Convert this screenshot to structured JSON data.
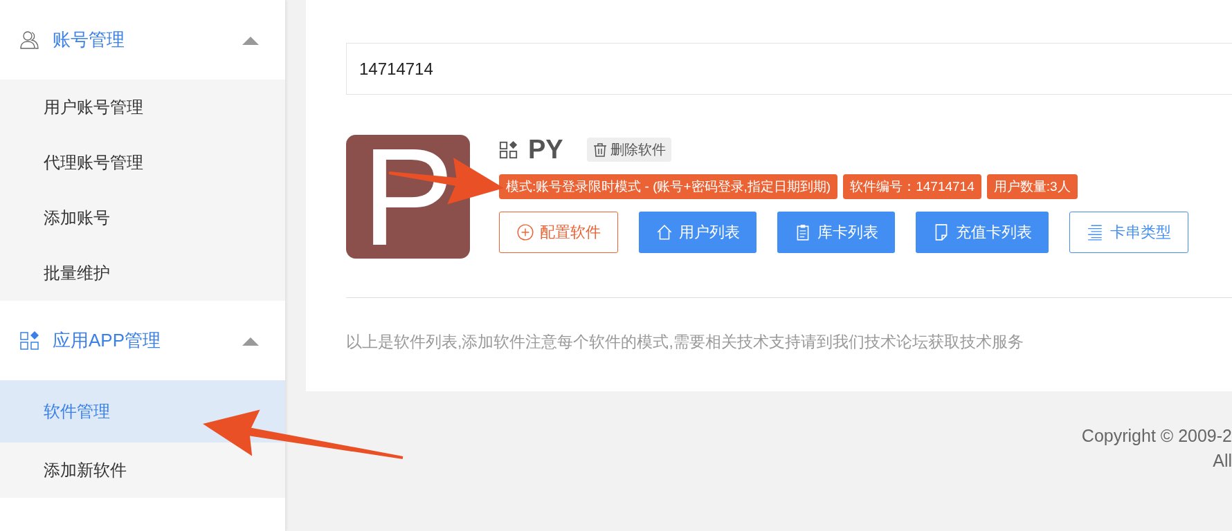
{
  "sidebar": {
    "groups": [
      {
        "label": "账号管理",
        "expanded": true,
        "items": [
          {
            "label": "用户账号管理",
            "selected": false
          },
          {
            "label": "代理账号管理",
            "selected": false
          },
          {
            "label": "添加账号",
            "selected": false
          },
          {
            "label": "批量维护",
            "selected": false
          }
        ]
      },
      {
        "label": "应用APP管理",
        "expanded": true,
        "items": [
          {
            "label": "软件管理",
            "selected": true
          },
          {
            "label": "添加新软件",
            "selected": false
          }
        ]
      }
    ]
  },
  "search": {
    "value": "14714714"
  },
  "software": {
    "icon_letter": "P",
    "name": "PY",
    "delete_label": "删除软件",
    "tags": [
      "模式:账号登录限时模式 - (账号+密码登录,指定日期到期)",
      "软件编号：14714714",
      "用户数量:3人"
    ],
    "buttons": [
      {
        "label": "配置软件",
        "kind": "warn-outline"
      },
      {
        "label": "用户列表",
        "kind": "primary"
      },
      {
        "label": "库卡列表",
        "kind": "primary"
      },
      {
        "label": "充值卡列表",
        "kind": "primary"
      },
      {
        "label": "卡串类型",
        "kind": "primary-outline"
      }
    ]
  },
  "note": "以上是软件列表,添加软件注意每个软件的模式,需要相关技术支持请到我们技术论坛获取技术服务",
  "footer": {
    "lines": [
      "Copyright © 2009-2",
      "All"
    ]
  }
}
